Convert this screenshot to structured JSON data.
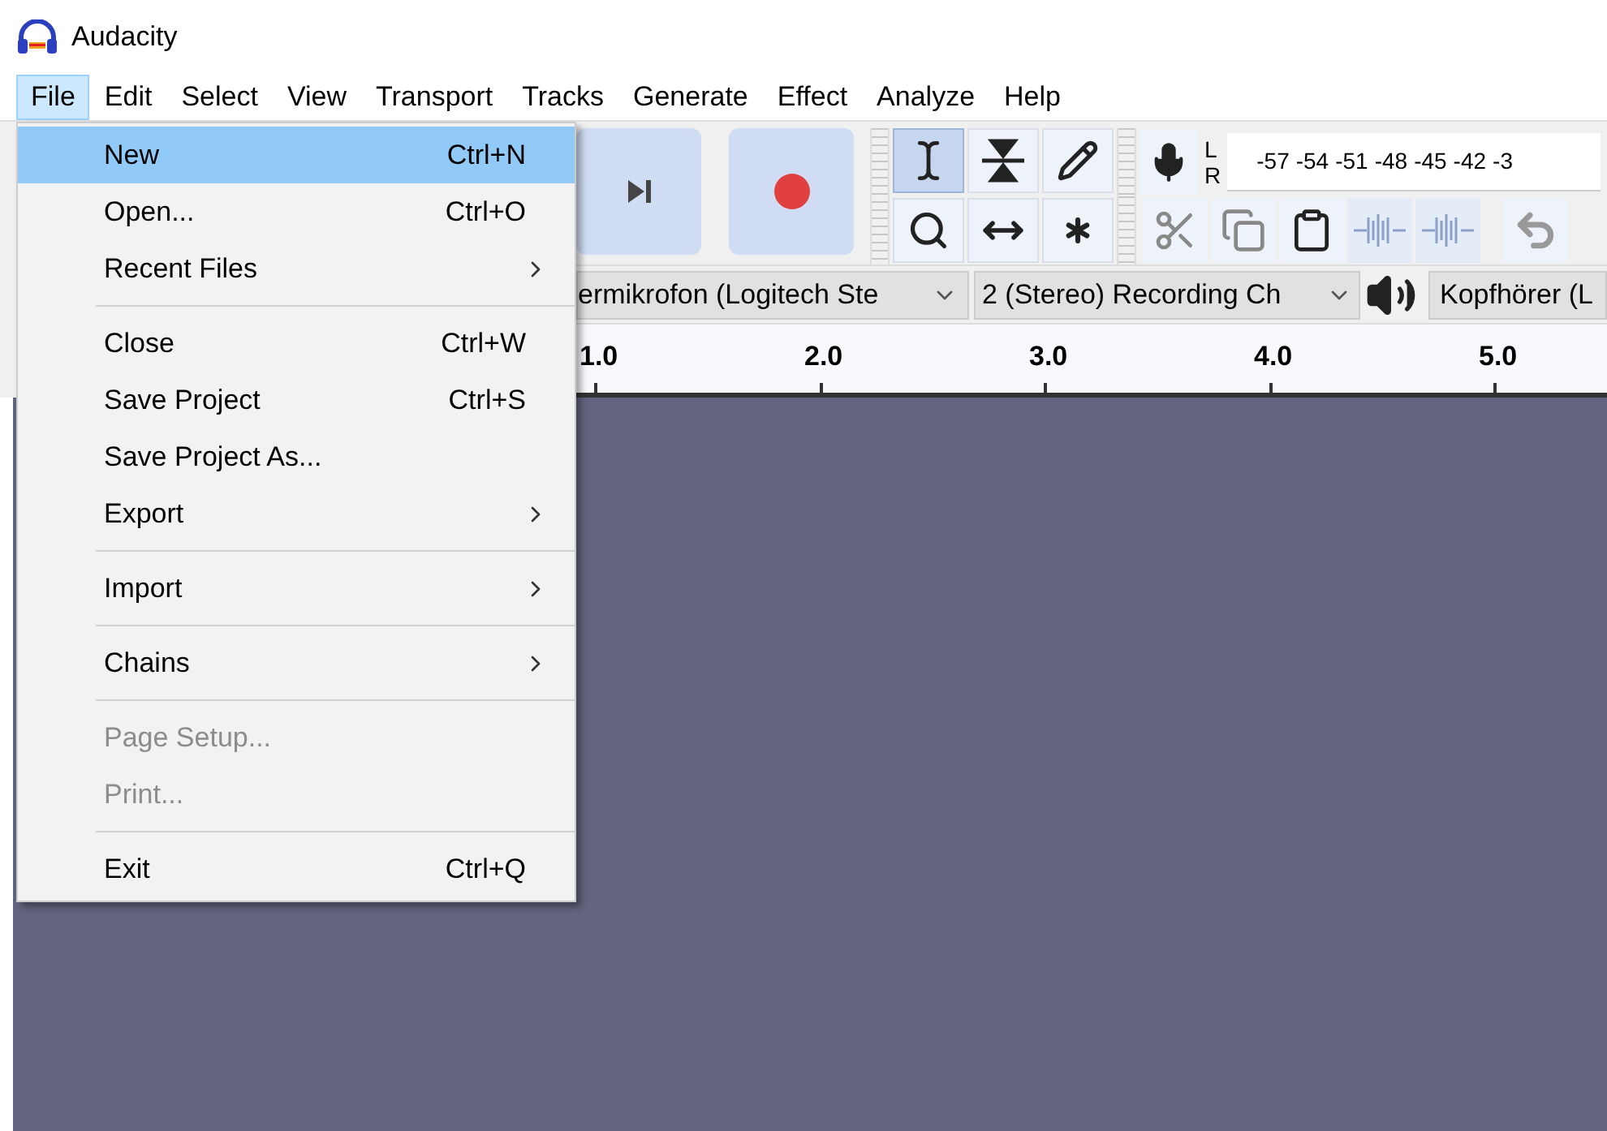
{
  "window": {
    "title": "Audacity"
  },
  "menu_bar": [
    {
      "label": "File",
      "selected": true
    },
    {
      "label": "Edit",
      "selected": false
    },
    {
      "label": "Select",
      "selected": false
    },
    {
      "label": "View",
      "selected": false
    },
    {
      "label": "Transport",
      "selected": false
    },
    {
      "label": "Tracks",
      "selected": false
    },
    {
      "label": "Generate",
      "selected": false
    },
    {
      "label": "Effect",
      "selected": false
    },
    {
      "label": "Analyze",
      "selected": false
    },
    {
      "label": "Help",
      "selected": false
    }
  ],
  "file_menu": {
    "items": [
      {
        "kind": "item",
        "label": "New",
        "shortcut": "Ctrl+N",
        "selected": true,
        "disabled": false
      },
      {
        "kind": "item",
        "label": "Open...",
        "shortcut": "Ctrl+O",
        "selected": false,
        "disabled": false
      },
      {
        "kind": "submenu",
        "label": "Recent Files",
        "selected": false,
        "disabled": false
      },
      {
        "kind": "separator"
      },
      {
        "kind": "item",
        "label": "Close",
        "shortcut": "Ctrl+W",
        "selected": false,
        "disabled": false
      },
      {
        "kind": "item",
        "label": "Save Project",
        "shortcut": "Ctrl+S",
        "selected": false,
        "disabled": false
      },
      {
        "kind": "item",
        "label": "Save Project As...",
        "selected": false,
        "disabled": false
      },
      {
        "kind": "submenu",
        "label": "Export",
        "selected": false,
        "disabled": false
      },
      {
        "kind": "separator"
      },
      {
        "kind": "submenu",
        "label": "Import",
        "selected": false,
        "disabled": false
      },
      {
        "kind": "separator"
      },
      {
        "kind": "submenu",
        "label": "Chains",
        "selected": false,
        "disabled": false
      },
      {
        "kind": "separator"
      },
      {
        "kind": "item",
        "label": "Page Setup...",
        "selected": false,
        "disabled": true
      },
      {
        "kind": "item",
        "label": "Print...",
        "selected": false,
        "disabled": true
      },
      {
        "kind": "separator"
      },
      {
        "kind": "item",
        "label": "Exit",
        "shortcut": "Ctrl+Q",
        "selected": false,
        "disabled": false
      }
    ]
  },
  "tools": [
    {
      "kind": "ibeam",
      "selected": true
    },
    {
      "kind": "envelope",
      "selected": false
    },
    {
      "kind": "draw",
      "selected": false
    },
    {
      "kind": "zoom",
      "selected": false
    },
    {
      "kind": "timeshift",
      "selected": false
    },
    {
      "kind": "multi",
      "selected": false
    }
  ],
  "meter": {
    "channels": [
      "L",
      "R"
    ],
    "ticks": [
      "-57",
      "-54",
      "-51",
      "-48",
      "-45",
      "-42",
      "-3"
    ]
  },
  "devices": {
    "recording_device": "ermikrofon (Logitech Ste",
    "recording_channels": "2 (Stereo) Recording Ch",
    "playback_device": "Kopfhörer (L"
  },
  "ruler": {
    "labels": [
      "1.0",
      "2.0",
      "3.0",
      "4.0",
      "5.0"
    ]
  }
}
